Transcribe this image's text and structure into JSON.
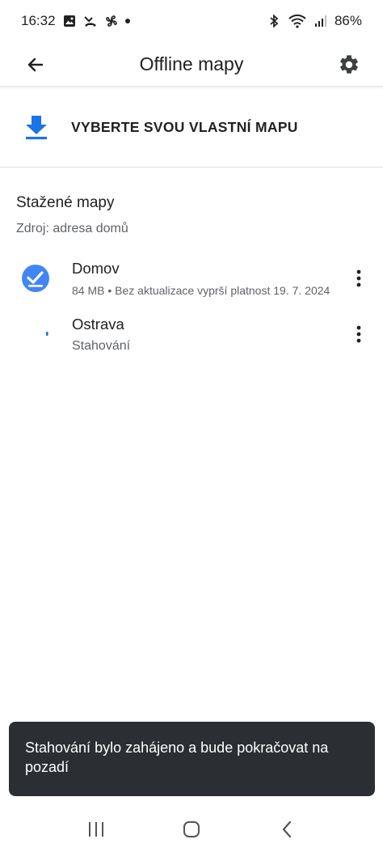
{
  "status_bar": {
    "time": "16:32",
    "battery": "86%",
    "left_icons": [
      "image-icon",
      "missed-call-icon",
      "pinwheel-icon",
      "dot-icon"
    ],
    "right_icons": [
      "bluetooth-icon",
      "wifi-icon",
      "signal-icon"
    ]
  },
  "app_bar": {
    "title": "Offline mapy",
    "back_icon": "arrow-back-icon",
    "settings_icon": "gear-icon"
  },
  "choose_map": {
    "label": "VYBERTE SVOU VLASTNÍ MAPU",
    "icon": "download-icon",
    "accent": "#1a73e8"
  },
  "downloaded": {
    "title": "Stažené mapy",
    "subtitle": "Zdroj: adresa domů",
    "items": [
      {
        "name": "Domov",
        "meta": "84 MB • Bez aktualizace vyprší platnost 19. 7. 2024",
        "status_icon": "check-circle-icon"
      },
      {
        "name": "Ostrava",
        "meta": "Stahování",
        "status_icon": "progress-spinner-icon"
      }
    ]
  },
  "snackbar": {
    "text": "Stahování bylo zahájeno a bude pokračovat na pozadí"
  },
  "nav_bar": {
    "icons": [
      "recents-icon",
      "home-icon",
      "back-icon"
    ]
  },
  "colors": {
    "accent": "#1a73e8",
    "text_primary": "#202124",
    "text_secondary": "#5f6368",
    "snackbar_bg": "#2b2e33"
  }
}
